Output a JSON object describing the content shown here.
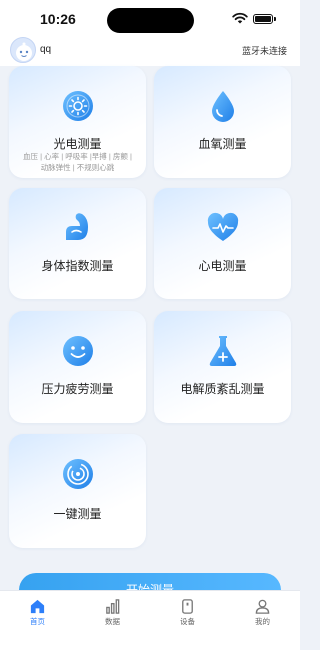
{
  "status_bar": {
    "time": "10:26"
  },
  "header": {
    "user_name": "qq",
    "bluetooth_status": "蓝牙未连接"
  },
  "cards": [
    {
      "title": "光电测量",
      "subtitle_lines": [
        "血压 | 心率 | 呼吸率 |早搏 | 房颤 |",
        "动脉弹性 | 不规则心跳"
      ],
      "icon": "sun-drop-icon"
    },
    {
      "title": "血氧测量",
      "icon": "water-drop-icon"
    },
    {
      "title": "身体指数测量",
      "icon": "flexed-arm-icon"
    },
    {
      "title": "心电测量",
      "icon": "heart-pulse-icon"
    },
    {
      "title": "压力疲劳测量",
      "icon": "smile-face-icon"
    },
    {
      "title": "电解质紊乱测量",
      "icon": "flask-icon"
    },
    {
      "title": "一键测量",
      "icon": "fingerprint-icon"
    }
  ],
  "start_button": {
    "label": "开始测量"
  },
  "tabs": [
    {
      "label": "首页",
      "icon": "home-icon",
      "active": true
    },
    {
      "label": "数据",
      "icon": "bar-chart-icon",
      "active": false
    },
    {
      "label": "设备",
      "icon": "device-icon",
      "active": false
    },
    {
      "label": "我的",
      "icon": "user-icon",
      "active": false
    }
  ],
  "colors": {
    "accent": "#2d7ff9",
    "icon_blue": "#2f8ff3",
    "background": "#eef2f8"
  }
}
